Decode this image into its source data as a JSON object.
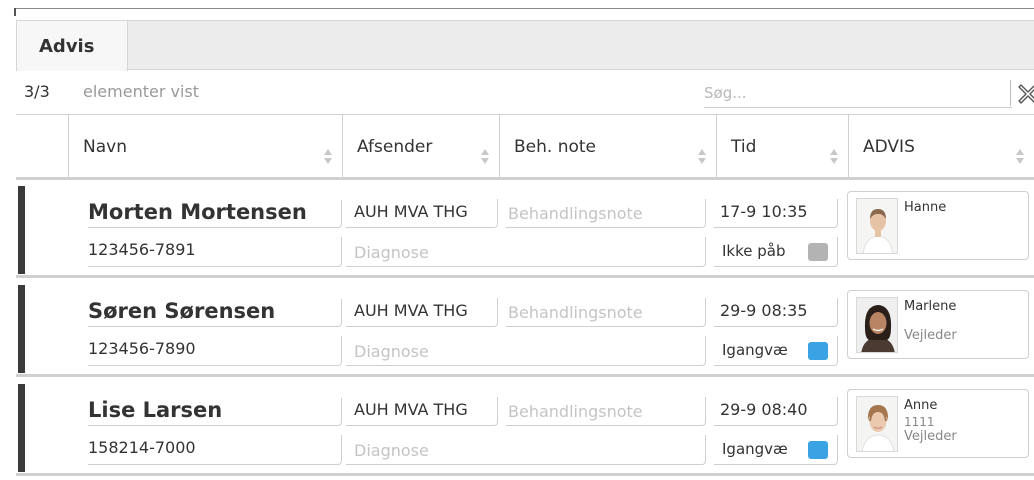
{
  "tab": {
    "label": "Advis"
  },
  "info": {
    "count": "3/3",
    "count_label": "elementer vist",
    "search_placeholder": "Søg..."
  },
  "columns": [
    {
      "label": "Navn"
    },
    {
      "label": "Afsender"
    },
    {
      "label": "Beh. note"
    },
    {
      "label": "Tid"
    },
    {
      "label": "ADVIS"
    }
  ],
  "rows": [
    {
      "name": "Morten Mortensen",
      "cpr": "123456-7891",
      "sender": "AUH MVA THG",
      "note_placeholder": "Behandlingsnote",
      "diagnosis_placeholder": "Diagnose",
      "time": "17-9 10:35",
      "status": "Ikke påb",
      "status_color": "#b3b3b3",
      "advis": {
        "name": "Hanne",
        "extra": "",
        "role": ""
      }
    },
    {
      "name": "Søren Sørensen",
      "cpr": "123456-7890",
      "sender": "AUH MVA THG",
      "note_placeholder": "Behandlingsnote",
      "diagnosis_placeholder": "Diagnose",
      "time": "29-9 08:35",
      "status": "Igangvæ",
      "status_color": "#3aa3e3",
      "advis": {
        "name": "Marlene",
        "extra": "",
        "role": "Vejleder"
      }
    },
    {
      "name": "Lise Larsen",
      "cpr": "158214-7000",
      "sender": "AUH MVA THG",
      "note_placeholder": "Behandlingsnote",
      "diagnosis_placeholder": "Diagnose",
      "time": "29-9 08:40",
      "status": "Igangvæ",
      "status_color": "#3aa3e3",
      "advis": {
        "name": "Anne",
        "extra": "1111",
        "role": "Vejleder"
      }
    }
  ]
}
